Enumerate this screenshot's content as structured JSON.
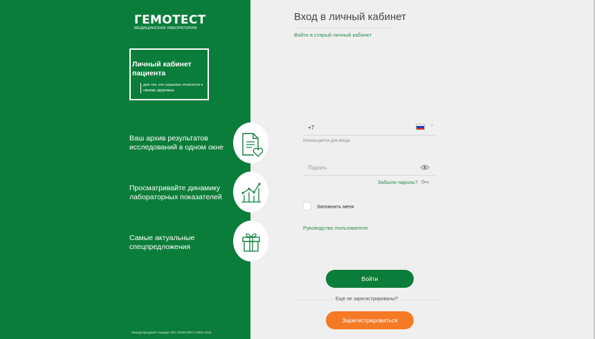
{
  "brand": {
    "name": "ГЕМОТЕСТ",
    "subtitle": "МЕДИЦИНСКАЯ ЛАБОРАТОРИЯ"
  },
  "promo": {
    "title": "Личный кабинет пациента",
    "subtitle": "для тех, кто серьезно относится к своему здоровью"
  },
  "features": [
    {
      "text": "Ваш архив результатов исследований в одном окне",
      "icon": "document-heart-icon"
    },
    {
      "text": "Просматривайте динамику лабораторных показателей",
      "icon": "chart-growth-icon"
    },
    {
      "text": "Самые актуальные спецпредложения",
      "icon": "gift-icon"
    }
  ],
  "iso_text": "Международный стандарт ISO 15189:2007 и 9001:2015",
  "login": {
    "title": "Вход в личный кабинет",
    "old_cabinet_link": "Войти в старый личный кабинет",
    "phone_prefix": "+7",
    "phone_hint": "Используется для входа",
    "password_placeholder": "Пароль",
    "forgot_password": "Забыли пароль?",
    "remember_me": "Запомнить меня",
    "user_guide": "Руководство пользователя",
    "login_button": "Войти",
    "not_registered": "Еще не зарегистрированы?",
    "register_button": "Зарегистрироваться"
  },
  "colors": {
    "brand_green": "#0b7d3a",
    "accent_orange": "#f57a25",
    "link_green": "#2d8a55"
  }
}
